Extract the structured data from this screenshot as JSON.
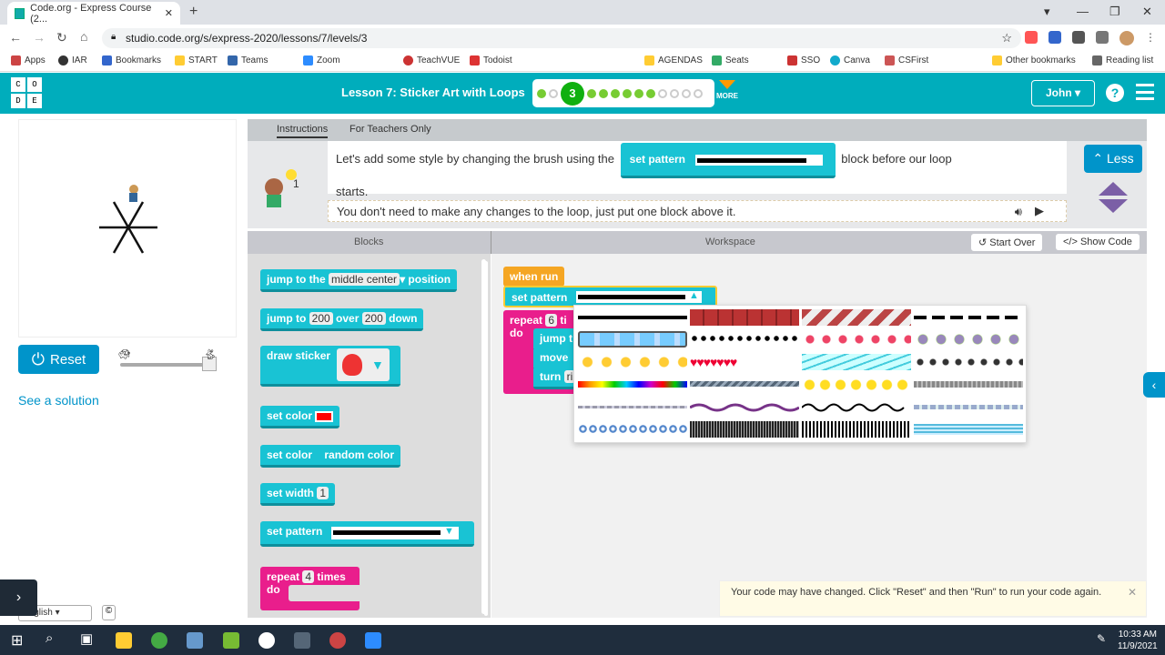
{
  "browser": {
    "tab_title": "Code.org - Express Course (2...",
    "url": "studio.code.org/s/express-2020/lessons/7/levels/3",
    "bookmarks": [
      "Apps",
      "IAR",
      "Bookmarks",
      "START",
      "Teams",
      "Zoom",
      "TeachVUE",
      "Todoist",
      "AGENDAS",
      "Seats",
      "SSO",
      "Canva",
      "CSFirst",
      "Other bookmarks",
      "Reading list"
    ]
  },
  "header": {
    "logo_letters": [
      "C",
      "O",
      "D",
      "E"
    ],
    "lesson_title": "Lesson 7: Sticker Art with Loops",
    "current_level": "3",
    "more_label": "MORE",
    "user_name": "John"
  },
  "left": {
    "reset_label": "Reset",
    "see_solution": "See a solution",
    "language": "English"
  },
  "instructions": {
    "tab_instructions": "Instructions",
    "tab_teachers": "For Teachers Only",
    "text_before": "Let's add some style by changing the brush using the",
    "inline_block_label": "set pattern",
    "text_after": "block before our loop",
    "text_line2": "starts.",
    "hint_text": "You don't need to make any changes to the loop, just put one block above it.",
    "less_label": "Less"
  },
  "editor": {
    "blocks_header": "Blocks",
    "workspace_header": "Workspace",
    "start_over": "Start Over",
    "show_code": "Show Code"
  },
  "toolbox": {
    "b1_prefix": "jump to the",
    "b1_field": "middle center",
    "b1_suffix": "position",
    "b2_prefix": "jump to",
    "b2_x": "200",
    "b2_mid": "over",
    "b2_y": "200",
    "b2_suffix": "down",
    "b3": "draw sticker",
    "b4": "set color",
    "b5_prefix": "set color",
    "b5_field": "random color",
    "b6_prefix": "set width",
    "b6_field": "1",
    "b7": "set pattern",
    "b8_prefix": "repeat",
    "b8_field": "4",
    "b8_suffix": "times",
    "b8_do": "do"
  },
  "workspace": {
    "when_run": "when run",
    "set_pattern": "set pattern",
    "repeat_prefix": "repeat",
    "repeat_field": "6",
    "repeat_suffix": "ti",
    "do": "do",
    "jump": "jump t",
    "move": "move",
    "turn": "turn",
    "turn_field": "ri"
  },
  "toast": {
    "message": "Your code may have changed. Click \"Reset\" and then \"Run\" to run your code again."
  },
  "taskbar": {
    "time": "10:33 AM",
    "date": "11/9/2021"
  },
  "colors": {
    "header": "#00adbc",
    "block_teal": "#19c3d4",
    "block_pink": "#e91e8c",
    "block_orange": "#f5a623",
    "button_blue": "#0094ca"
  }
}
